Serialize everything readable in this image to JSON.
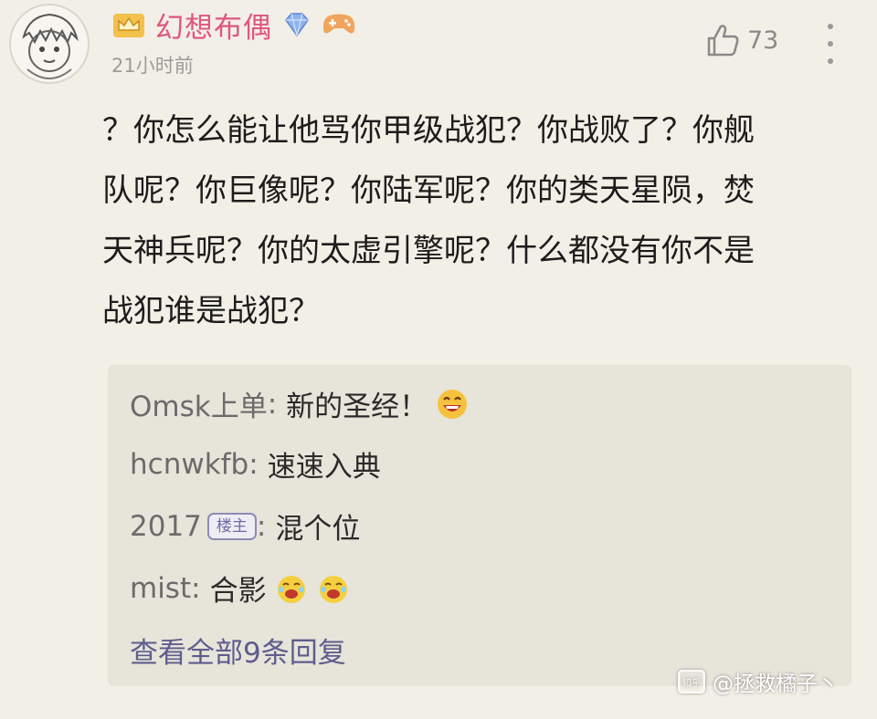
{
  "comment": {
    "username": "幻想布偶",
    "time": "21小时前",
    "likes": "73",
    "lines": [
      "？你怎么能让他骂你甲级战犯？你战败了？你舰",
      "队呢？你巨像呢？你陆军呢？你的类天星陨，焚",
      "天神兵呢？你的太虚引擎呢？什么都没有你不是",
      "战犯谁是战犯？"
    ],
    "icons": [
      "avatar",
      "crown-icon",
      "diamond-icon",
      "gamepad-icon",
      "thumbs-up-icon",
      "more-icon"
    ]
  },
  "replies": [
    {
      "user": "Omsk上单",
      "sep": ":",
      "text": "新的圣经！",
      "badge": "",
      "emoji": "grin-emoji"
    },
    {
      "user": "hcnwkfb",
      "sep": ":",
      "text": "速速入典",
      "badge": "",
      "emoji": ""
    },
    {
      "user": "2017",
      "sep": ":",
      "text": "混个位",
      "badge": "楼主",
      "emoji": ""
    },
    {
      "user": "mist",
      "sep": ":",
      "text": "合影",
      "badge": "",
      "emoji": "laugh-emoji x2"
    }
  ],
  "view_all": "查看全部9条回复",
  "watermark": {
    "logo": "知乎",
    "text": "@拯救橘子丶"
  },
  "colors": {
    "username": "#e0567c",
    "link": "#5e5d8c",
    "background": "#f2efe6",
    "reply_box": "#e7e4da"
  }
}
